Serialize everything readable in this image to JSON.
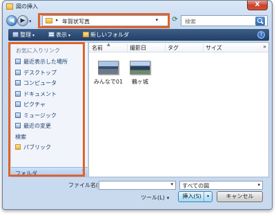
{
  "window": {
    "title": "図の挿入",
    "close_glyph": "X"
  },
  "nav": {
    "back_glyph": "◀",
    "forward_glyph": "▶",
    "path_sep": "▸",
    "path": "年賀状写真",
    "address_chevron": "▾",
    "refresh_glyph": "⟳"
  },
  "search": {
    "placeholder": "検索"
  },
  "toolbar": {
    "organize": "整理",
    "views": "表示",
    "new_folder": "新しいフォルダ",
    "caret": "▾",
    "help": "?"
  },
  "sidebar": {
    "title": "お気に入りリンク",
    "items": [
      {
        "label": "最近表示した場所",
        "icon": "recent-places-icon"
      },
      {
        "label": "デスクトップ",
        "icon": "desktop-icon"
      },
      {
        "label": "コンピュータ",
        "icon": "computer-icon"
      },
      {
        "label": "ドキュメント",
        "icon": "documents-icon"
      },
      {
        "label": "ピクチャ",
        "icon": "pictures-icon"
      },
      {
        "label": "ミュージック",
        "icon": "music-icon"
      },
      {
        "label": "最近の変更",
        "icon": "recently-changed-icon"
      },
      {
        "label": "検索",
        "icon": "searches-icon"
      },
      {
        "label": "パブリック",
        "icon": "public-folder-icon"
      }
    ],
    "folders_label": "フォルダ",
    "folders_chevron": "˄"
  },
  "columns": {
    "name": "名前",
    "date": "撮影日",
    "tags": "タグ",
    "size": "サイズ",
    "sort_glyph": "▲",
    "more": "»"
  },
  "files": [
    {
      "name": "みんなで01"
    },
    {
      "name": "鶴ヶ城"
    }
  ],
  "footer": {
    "file_name_label": "ファイル名(N):",
    "file_name_value": "",
    "file_name_chevron": "▾",
    "file_type": "すべての図",
    "file_type_chevron": "▾",
    "tools": "ツール(L)",
    "tools_chevron": "▾",
    "insert": "挿入(S)",
    "insert_dd": "▾",
    "cancel": "キャンセル"
  },
  "colors": {
    "highlight": "#e0622a",
    "toolbar": "#2b4a73"
  }
}
